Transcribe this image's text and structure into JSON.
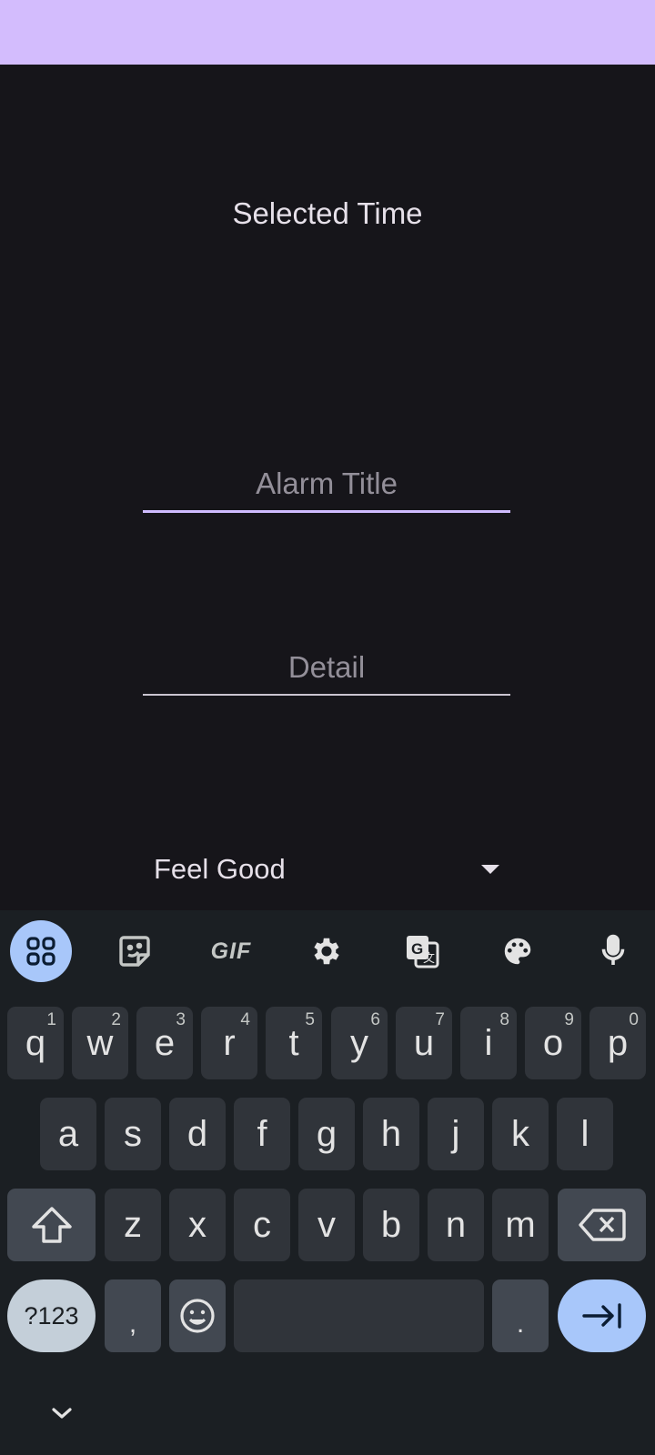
{
  "screen": {
    "selected_time_label": "Selected Time",
    "alarm_title": {
      "placeholder": "Alarm Title",
      "value": ""
    },
    "detail": {
      "placeholder": "Detail",
      "value": ""
    },
    "sound_dropdown": {
      "selected": "Feel Good"
    }
  },
  "keyboard": {
    "toolbar": [
      "apps-icon",
      "sticker-icon",
      "GIF",
      "settings-icon",
      "translate-icon",
      "palette-icon",
      "mic-icon"
    ],
    "gif_label": "GIF",
    "row1": [
      {
        "k": "q",
        "h": "1"
      },
      {
        "k": "w",
        "h": "2"
      },
      {
        "k": "e",
        "h": "3"
      },
      {
        "k": "r",
        "h": "4"
      },
      {
        "k": "t",
        "h": "5"
      },
      {
        "k": "y",
        "h": "6"
      },
      {
        "k": "u",
        "h": "7"
      },
      {
        "k": "i",
        "h": "8"
      },
      {
        "k": "o",
        "h": "9"
      },
      {
        "k": "p",
        "h": "0"
      }
    ],
    "row2": [
      "a",
      "s",
      "d",
      "f",
      "g",
      "h",
      "j",
      "k",
      "l"
    ],
    "row3": [
      "z",
      "x",
      "c",
      "v",
      "b",
      "n",
      "m"
    ],
    "symbols_label": "?123",
    "comma_label": ",",
    "period_label": "."
  },
  "colors": {
    "status_bar": "#d3bcfd",
    "background": "#16151a",
    "keyboard_bg": "#1b1f23",
    "accent_blue": "#a8c7fa"
  }
}
